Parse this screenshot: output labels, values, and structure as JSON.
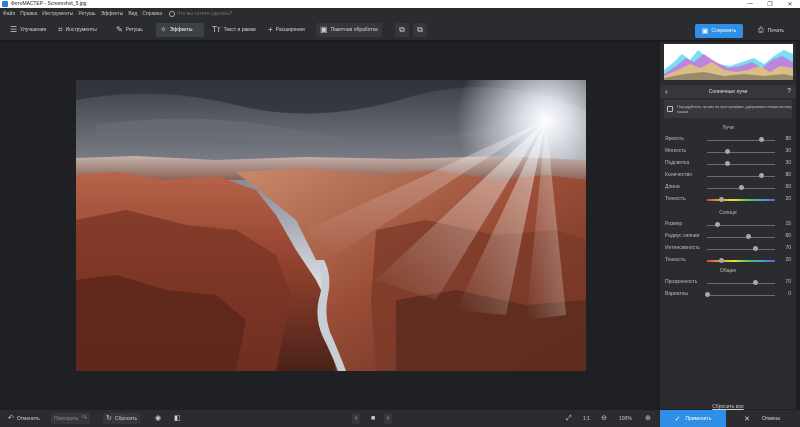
{
  "window": {
    "title": "ФотоМАСТЕР - Screenshot_5.jpg",
    "controls": [
      "—",
      "❐",
      "✕"
    ]
  },
  "menu": {
    "items": [
      "Файл",
      "Правка",
      "Инструменты",
      "Ретушь",
      "Эффекты",
      "Вид",
      "Справка"
    ],
    "search_placeholder": "Что вы хотите сделать?"
  },
  "toolbar": {
    "tools": [
      {
        "label": "Улучшения",
        "icon": "sliders-icon"
      },
      {
        "label": "Инструменты",
        "icon": "crop-icon"
      },
      {
        "label": "Ретушь",
        "icon": "brush-icon"
      },
      {
        "label": "Эффекты",
        "icon": "magic-icon",
        "active": true
      },
      {
        "label": "Текст и рамки",
        "icon": "text-icon"
      },
      {
        "label": "Расширения",
        "icon": "plus-icon"
      },
      {
        "label": "Пакетная обработка",
        "icon": "batch-icon"
      }
    ],
    "save_label": "Сохранить",
    "print_label": "Печать"
  },
  "panel": {
    "title": "Солнечные лучи",
    "info": "Порадуйтесь лучам по фотографии, удерживая левую кнопку мыши",
    "sections": [
      {
        "title": "Лучи",
        "sliders": [
          {
            "label": "Яркость",
            "value": 80,
            "position": 0.8,
            "rainbow": false
          },
          {
            "label": "Мягкость",
            "value": 30,
            "position": 0.3,
            "rainbow": false
          },
          {
            "label": "Подсветка",
            "value": 30,
            "position": 0.3,
            "rainbow": false
          },
          {
            "label": "Количество",
            "value": 80,
            "position": 0.8,
            "rainbow": false
          },
          {
            "label": "Длина",
            "value": 50,
            "position": 0.5,
            "rainbow": false
          },
          {
            "label": "Тонкость",
            "value": 20,
            "position": 0.2,
            "rainbow": true
          }
        ]
      },
      {
        "title": "Солнце",
        "sliders": [
          {
            "label": "Размер",
            "value": 15,
            "position": 0.15,
            "rainbow": false
          },
          {
            "label": "Радиус сияния",
            "value": 60,
            "position": 0.6,
            "rainbow": false
          },
          {
            "label": "Интенсивность",
            "value": 70,
            "position": 0.7,
            "rainbow": false
          },
          {
            "label": "Тонкость",
            "value": 20,
            "position": 0.2,
            "rainbow": true
          }
        ]
      },
      {
        "title": "Общее",
        "sliders": [
          {
            "label": "Прозрачность",
            "value": 70,
            "position": 0.7,
            "rainbow": false
          },
          {
            "label": "Вариатны",
            "value": 0,
            "position": 0.0,
            "rainbow": false
          }
        ]
      }
    ],
    "reset_all": "Сбросить все"
  },
  "bottom": {
    "undo_label": "Отменить",
    "redo_label": "Повторить",
    "reset_label": "Сбросить",
    "zoom_fit": "1:1",
    "zoom_level": "100%",
    "apply_label": "Применить",
    "cancel_label": "Отмена"
  }
}
